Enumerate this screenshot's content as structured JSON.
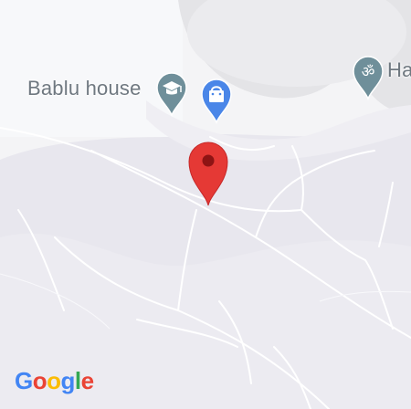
{
  "map": {
    "places": [
      {
        "label": "Bablu house",
        "icon": "graduation-cap-icon",
        "color": "#6f8f9a"
      },
      {
        "label": "",
        "icon": "shopping-bag-icon",
        "color": "#4a86e8"
      },
      {
        "label": "Ha",
        "icon": "om-temple-icon",
        "color": "#6f8f9a"
      }
    ],
    "selected_pin": {
      "icon": "location-pin-icon",
      "color": "#e53935"
    },
    "attribution": {
      "logo_text": "Google",
      "letters": [
        "G",
        "o",
        "o",
        "g",
        "l",
        "e"
      ],
      "letter_colors": [
        "#4285F4",
        "#EA4335",
        "#FBBC05",
        "#4285F4",
        "#34A853",
        "#EA4335"
      ]
    }
  },
  "colors": {
    "road": "#ffffff",
    "background": "#f2f2f5",
    "photo_overlay": "#dcdce2"
  }
}
